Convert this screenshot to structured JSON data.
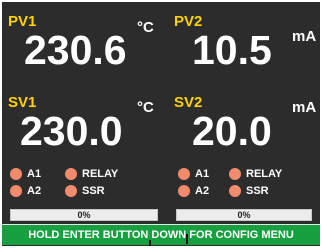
{
  "channels": [
    {
      "pv_label": "PV1",
      "pv_value": "230.6",
      "pv_unit": "°C",
      "sv_label": "SV1",
      "sv_value": "230.0",
      "sv_unit": "°C",
      "indicators": [
        "A1",
        "RELAY",
        "A2",
        "SSR"
      ],
      "progress_label": "0%",
      "progress": 0
    },
    {
      "pv_label": "PV2",
      "pv_value": "10.5",
      "pv_unit": "mA",
      "sv_label": "SV2",
      "sv_value": "20.0",
      "sv_unit": "mA",
      "indicators": [
        "A1",
        "RELAY",
        "A2",
        "SSR"
      ],
      "progress_label": "0%",
      "progress": 0
    }
  ],
  "footer_message": "HOLD ENTER BUTTON DOWN FOR CONFIG MENU",
  "colors": {
    "background": "#2c2c2c",
    "label": "#ffd200",
    "value": "#ffffff",
    "led": "#f28b6c",
    "footer": "#17a040"
  }
}
